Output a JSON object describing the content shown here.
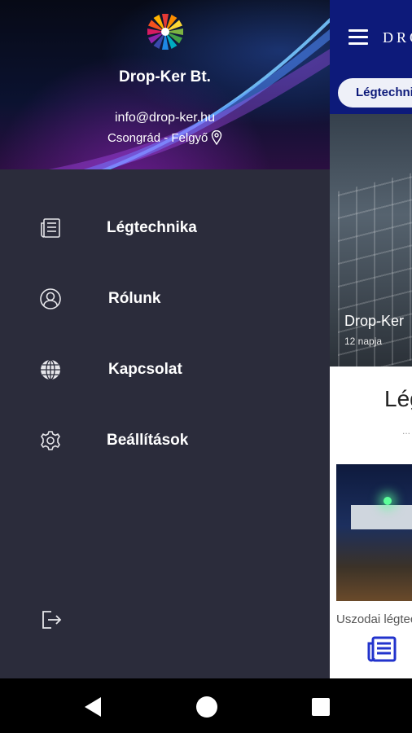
{
  "background_app": {
    "brand": "DROP",
    "active_tab": "Légtechnika",
    "hero": {
      "title": "Drop-Ker",
      "subtitle": "12 napja"
    },
    "section_title": "Légtechnika",
    "section_dots": "...",
    "card_caption": "Uszodai légtechnika"
  },
  "drawer": {
    "company_name": "Drop-Ker Bt.",
    "email": "info@drop-ker.hu",
    "location": "Csongrád - Felgyő",
    "menu": [
      {
        "label": "Légtechnika",
        "icon": "newspaper-icon"
      },
      {
        "label": "Rólunk",
        "icon": "person-icon"
      },
      {
        "label": "Kapcsolat",
        "icon": "globe-icon"
      },
      {
        "label": "Beállítások",
        "icon": "gear-icon"
      }
    ],
    "logout_icon": "logout-icon"
  },
  "colors": {
    "app_bar": "#0d1a7a",
    "drawer_bg": "#2b2c3b",
    "accent": "#2233cc"
  }
}
